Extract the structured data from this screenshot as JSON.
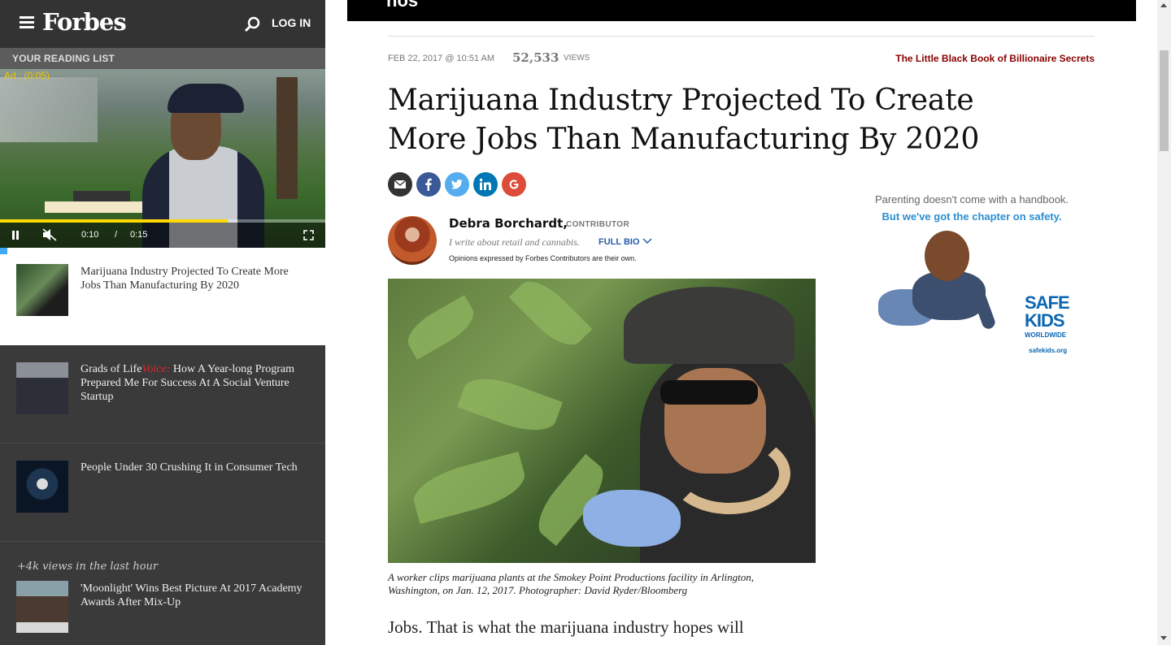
{
  "header": {
    "logo": "Forbes",
    "login_label": "LOG IN"
  },
  "reading_list": {
    "heading": "YOUR READING LIST",
    "video": {
      "ad_label": "Ad : (0:05)",
      "current_time": "0:10",
      "separator": "/",
      "duration": "0:15",
      "progress": 0.7
    },
    "items": [
      {
        "title": "Marijuana Industry Projected To Create More Jobs Than Manufacturing By 2020"
      },
      {
        "title_prefix": "Grads of Life",
        "voice_label": "Voice:",
        "title_suffix": " How A Year-long Program Prepared Me For Success At A Social Venture Startup"
      },
      {
        "title": "People Under 30 Crushing It in Consumer Tech"
      },
      {
        "trending_label": "+4k views in the last hour",
        "title": "'Moonlight' Wins Best Picture At 2017 Academy Awards After Mix-Up"
      }
    ]
  },
  "article": {
    "banner_text": "nos",
    "date": "FEB 22, 2017 @ 10:51 AM",
    "view_count": "52,533",
    "views_label": "VIEWS",
    "promo_link": "The Little Black Book of Billionaire Secrets",
    "headline": "Marijuana Industry Projected To Create More Jobs Than Manufacturing By 2020",
    "share_icons": [
      "email-icon",
      "facebook-icon",
      "twitter-icon",
      "linkedin-icon",
      "google-plus-icon"
    ],
    "share_colors": {
      "email": "#333333",
      "facebook": "#3b5998",
      "twitter": "#55acee",
      "linkedin": "#0077b5",
      "google": "#dd4b39"
    },
    "author": {
      "name": "Debra Borchardt,",
      "role": "CONTRIBUTOR",
      "bio": "I write about retail and cannabis.",
      "full_bio_label": "FULL BIO",
      "disclaimer": "Opinions expressed by Forbes Contributors are their own."
    },
    "photo_caption": "A worker clips marijuana plants at the Smokey Point Productions facility in Arlington, Washington, on Jan. 12, 2017.  Photographer: David Ryder/Bloomberg",
    "body_start": "Jobs. That is what the marijuana industry hopes will"
  },
  "ad": {
    "line1": "Parenting doesn't come with a handbook.",
    "line2": "But we've got the chapter on safety.",
    "brand_safe": "SAFE",
    "brand_kids": "KIDS",
    "brand_worldwide": "WORLDWIDE",
    "brand_url": "safekids.org"
  }
}
